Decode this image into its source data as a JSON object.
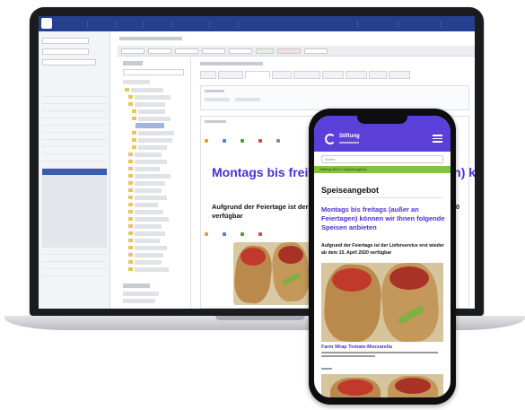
{
  "laptop": {
    "cms": {
      "heading": "Montags bis freitags (außer an Feiertagen) können wir Ihnen folgende Speisen anbieten",
      "subheading": "Aufgrund der Feiertage ist der Lieferservice erst wieder ab dem 15. April 2020 verfügbar"
    }
  },
  "phone": {
    "brand": "Stiftung",
    "search_placeholder": "Suche",
    "breadcrumb": "Stiftung Eins • Speiseangebot",
    "page_title": "Speiseangebot",
    "heading": "Montags bis freitags (außer an Feiertagen) können wir Ihnen folgende Speisen anbieten",
    "subheading": "Aufgrund der Feiertage ist der Lieferservice erst wieder ab dem 15. April 2020 verfügbar",
    "item_link": "Farm Wrap Tomate-Mozzarella"
  },
  "colors": {
    "cms_topbar": "#26408f",
    "accent_purple": "#5b3fd9",
    "heading_purple": "#4a2fd6",
    "breadcrumb_green": "#82c341"
  }
}
